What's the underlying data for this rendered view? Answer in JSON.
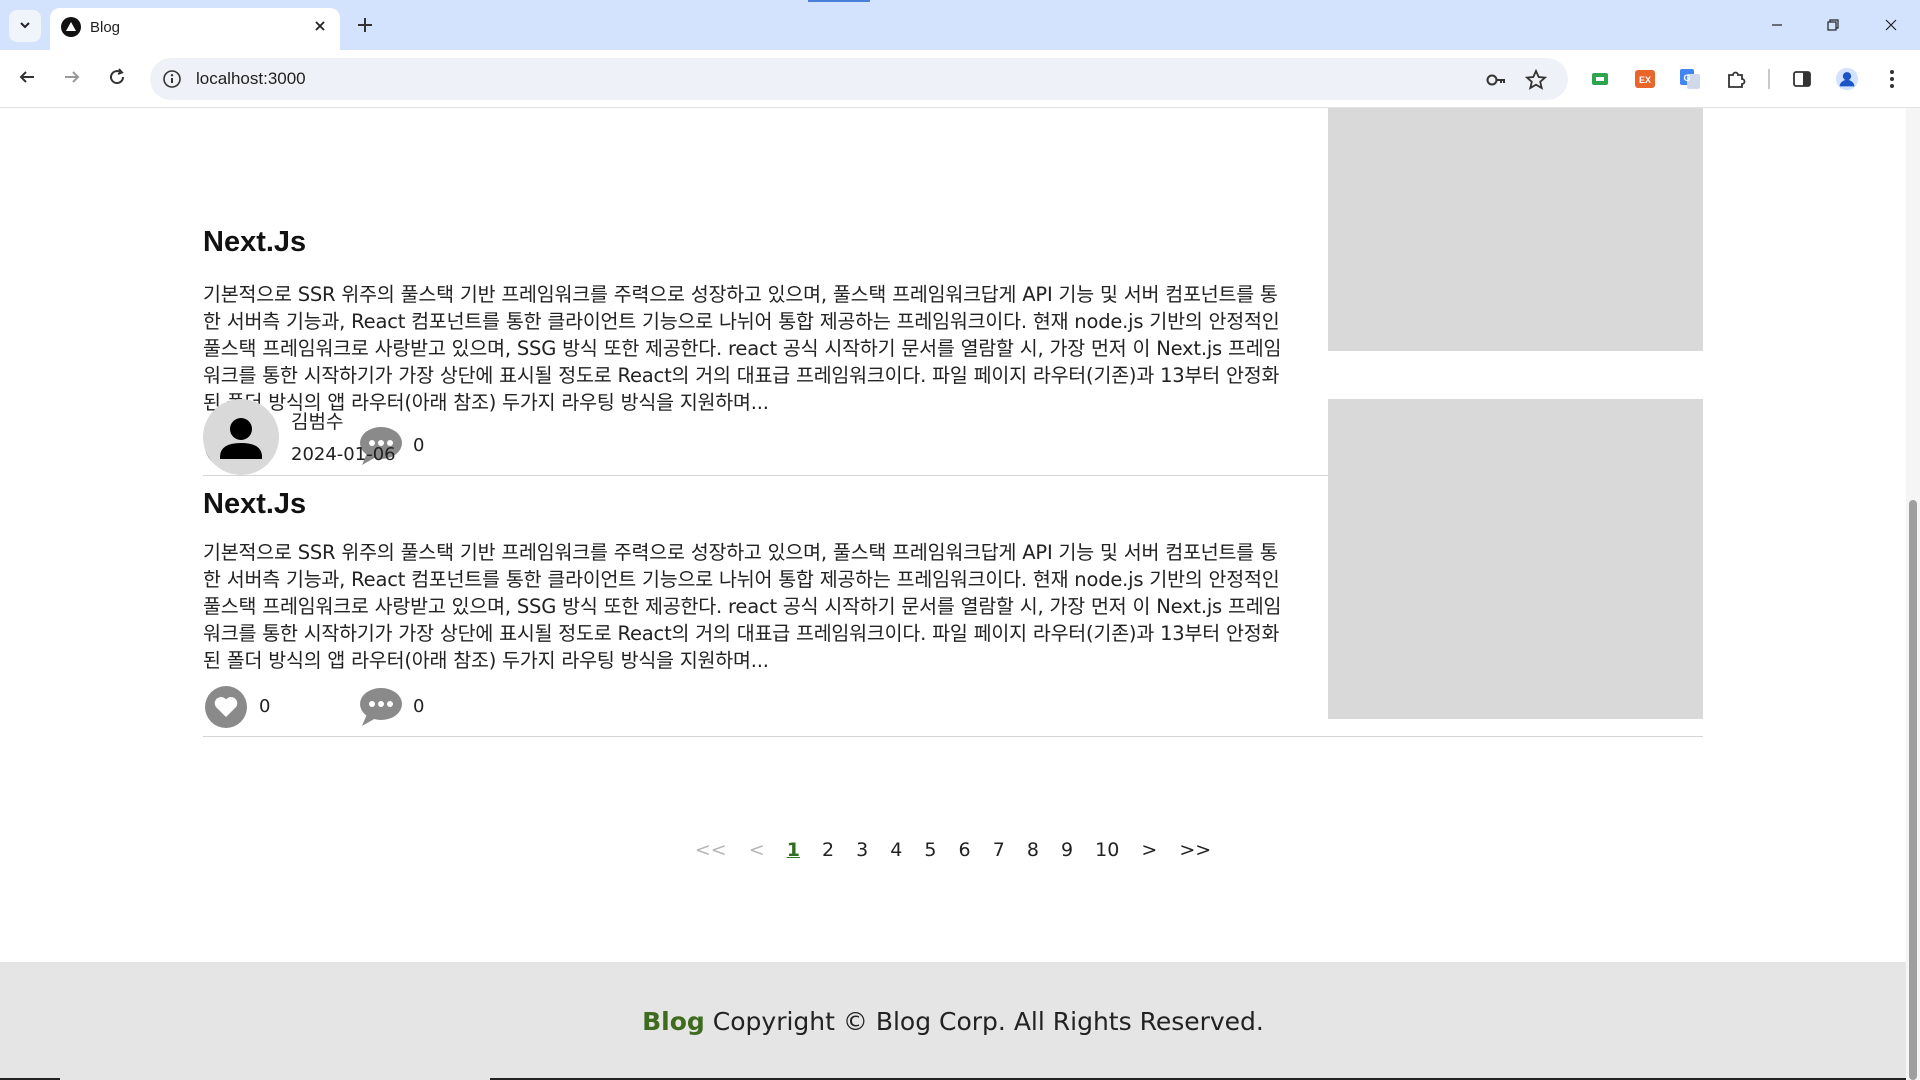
{
  "browser": {
    "tab_title": "Blog",
    "url": "localhost:3000"
  },
  "posts": [
    {
      "author": "",
      "date": "",
      "title": "Next.Js",
      "body": "기본적으로 SSR 위주의 풀스택 기반 프레임워크를 주력으로 성장하고 있으며, 풀스택 프레임워크답게 API 기능 및 서버 컴포넌트를 통한 서버측 기능과, React 컴포넌트를 통한 클라이언트 기능으로 나뉘어 통합 제공하는 프레임워크이다. 현재 node.js 기반의 안정적인 풀스택 프레임워크로 사랑받고 있으며, SSG 방식 또한 제공한다. react 공식 시작하기 문서를 열람할 시, 가장 먼저 이 Next.js 프레임워크를 통한 시작하기가 가장 상단에 표시될 정도로 React의 거의 대표급 프레임워크이다. 파일 페이지 라우터(기존)과 13부터 안정화된 폴더 방식의 앱 라우터(아래 참조) 두가지 라우팅 방식을 지원하며...",
      "likes": "0",
      "comments": "0"
    },
    {
      "author": "김범수",
      "date": "2024-01-06",
      "title": "Next.Js",
      "body": "기본적으로 SSR 위주의 풀스택 기반 프레임워크를 주력으로 성장하고 있으며, 풀스택 프레임워크답게 API 기능 및 서버 컴포넌트를 통한 서버측 기능과, React 컴포넌트를 통한 클라이언트 기능으로 나뉘어 통합 제공하는 프레임워크이다. 현재 node.js 기반의 안정적인 풀스택 프레임워크로 사랑받고 있으며, SSG 방식 또한 제공한다. react 공식 시작하기 문서를 열람할 시, 가장 먼저 이 Next.js 프레임워크를 통한 시작하기가 가장 상단에 표시될 정도로 React의 거의 대표급 프레임워크이다. 파일 페이지 라우터(기존)과 13부터 안정화된 폴더 방식의 앱 라우터(아래 참조) 두가지 라우팅 방식을 지원하며...",
      "likes": "0",
      "comments": "0"
    }
  ],
  "pagination": {
    "first": "<<",
    "prev": "<",
    "pages": [
      "1",
      "2",
      "3",
      "4",
      "5",
      "6",
      "7",
      "8",
      "9",
      "10"
    ],
    "current": "1",
    "next": ">",
    "last": ">>"
  },
  "footer": {
    "brand": "Blog",
    "text": " Copyright © Blog Corp. All Rights Reserved."
  },
  "colors": {
    "accent": "#3f6b1f",
    "tabbar": "#d3e3fd",
    "placeholder": "#d9d9d9"
  }
}
